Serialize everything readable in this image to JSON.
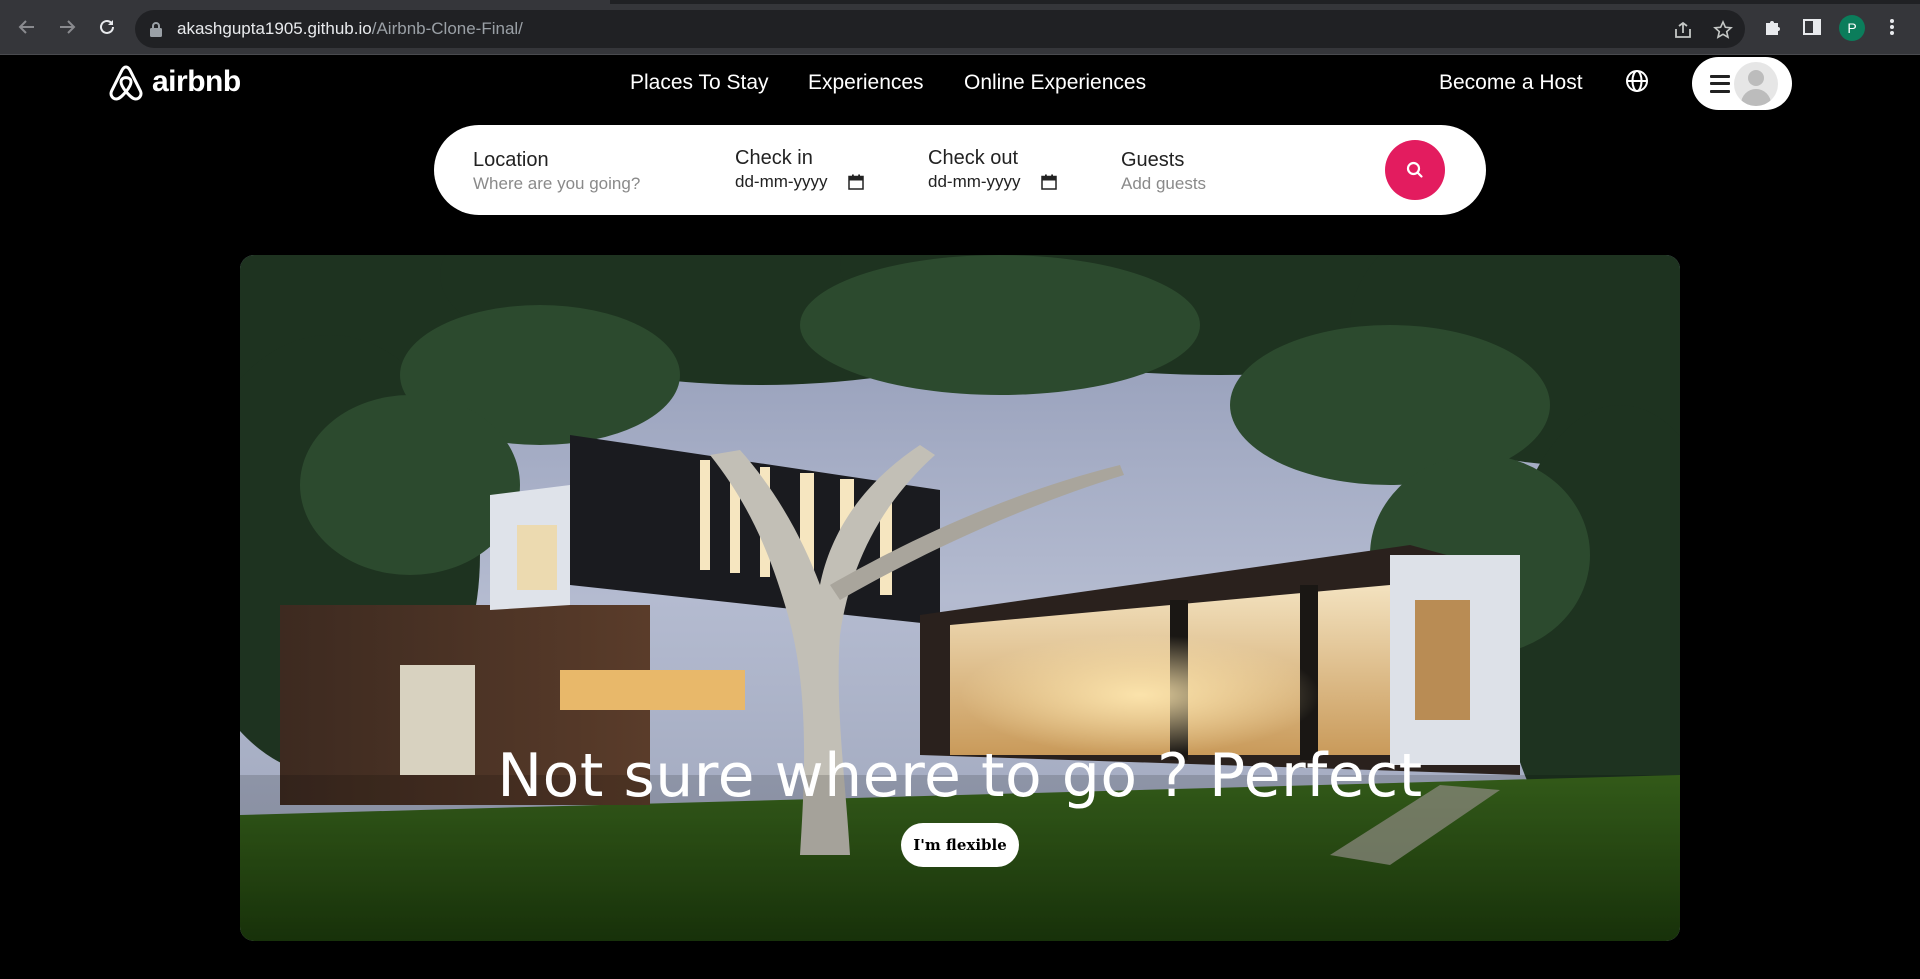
{
  "browser": {
    "url_host": "akashgupta1905.github.io",
    "url_path": "/Airbnb-Clone-Final/",
    "profile_initial": "P"
  },
  "header": {
    "logo_text": "airbnb",
    "nav": [
      "Places To Stay",
      "Experiences",
      "Online Experiences"
    ],
    "become_host": "Become a Host"
  },
  "search": {
    "location_label": "Location",
    "location_placeholder": "Where are you going?",
    "checkin_label": "Check in",
    "checkin_placeholder": "dd-mm-yyyy",
    "checkout_label": "Check out",
    "checkout_placeholder": "dd-mm-yyyy",
    "guests_label": "Guests",
    "guests_placeholder": "Add guests"
  },
  "hero": {
    "title": "Not sure where to go ? Perfect",
    "button": "I'm flexible"
  },
  "colors": {
    "accent": "#e31c5f",
    "profile": "#0b7d5b"
  }
}
